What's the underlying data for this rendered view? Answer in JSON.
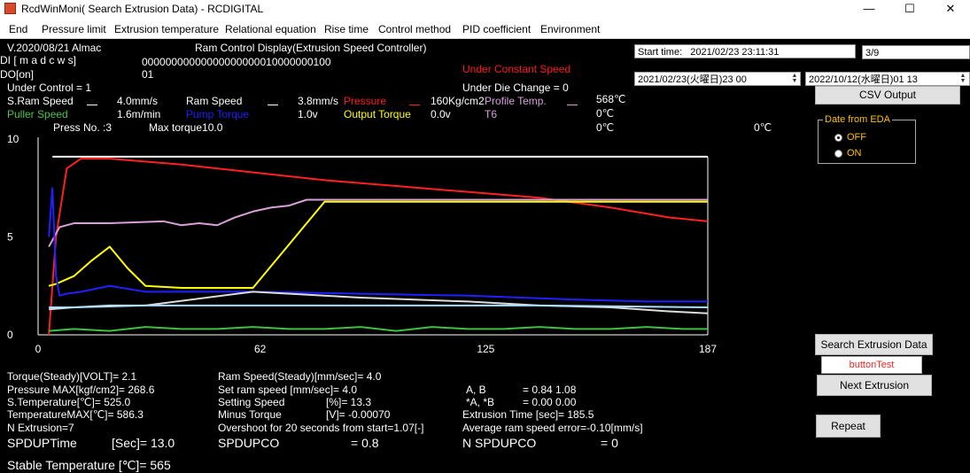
{
  "window": {
    "title": "RcdWinMoni( Search Extrusion Data) - RCDIGITAL",
    "minimize": "—",
    "maximize": "☐",
    "close": "✕"
  },
  "menu": [
    "End",
    "Pressure limit",
    "Extrusion temperature",
    "Relational equation",
    "Rise time",
    "Control method",
    "PID coefficient",
    "Environment"
  ],
  "header": {
    "version": "V.2020/08/21 Almac",
    "display_title": "Ram Control Display(Extrusion Speed Controller)",
    "di_label": "DI [ m a d c w s]",
    "di_value": "00000000000000000000010000000100",
    "do_label": "DO[on]",
    "do_value": "01",
    "under_constant_speed": "Under Constant Speed",
    "under_control": "Under Control = 1",
    "under_die_change": "Under Die Change = 0"
  },
  "readings": {
    "s_ram_speed_label": "S.Ram Speed",
    "s_ram_speed_value": "4.0mm/s",
    "ram_speed_label": "Ram Speed",
    "ram_speed_value": "3.8mm/s",
    "pressure_label": "Pressure",
    "pressure_value": "160Kg/cm2",
    "profile_temp_label": "Profile Temp.",
    "profile_temp_value": "568℃",
    "puller_speed_label": "Puller Speed",
    "puller_speed_value": "1.6m/min",
    "pump_torque_label": "Pump Torque",
    "pump_torque_value": "1.0v",
    "output_torque_label": "Output Torque",
    "output_torque_value": "0.0v",
    "t6_label": "T6",
    "t6_value": "0℃",
    "press_no": "Press No. :3",
    "max_torque": "Max torque10.0",
    "temp_a": "0℃",
    "temp_b": "0℃"
  },
  "right_panel": {
    "start_time_label": "Start time:",
    "start_time_value": "2021/02/23 23:11:31",
    "page": "3/9",
    "date_from": "2021/02/23(火曜日)23 00",
    "date_to": "2022/10/12(水曜日)01 13",
    "csv_output": "CSV Output",
    "eda_group": "Date from EDA",
    "eda_off": "OFF",
    "eda_on": "ON",
    "search_button": "Search Extrusion Data",
    "button_test": "buttonTest",
    "next_button": "Next Extrusion",
    "repeat_button": "Repeat"
  },
  "stats": {
    "torque": "Torque(Steady)[VOLT]= 2.1",
    "pressure_max": "Pressure MAX[kgf/cm2]= 268.6",
    "s_temperature": "S.Temperature[℃]= 525.0",
    "temperature_max": "TemperatureMAX[℃]= 586.3",
    "n_extrusion": "N Extrusion=7",
    "spdup_time_label": "SPDUPTime",
    "spdup_time_value": "[Sec]= 13.0",
    "stable_temp": "Stable  Temperature [℃]= 565",
    "ram_speed_steady": "Ram Speed(Steady)[mm/sec]= 4.0",
    "set_ram_speed": "Set ram speed [mm/sec]= 4.0",
    "setting_speed_label": "Setting Speed",
    "setting_speed_value": "[%]= 13.3",
    "minus_torque_label": "Minus Torque",
    "minus_torque_value": "[V]= -0.00070",
    "overshoot": "Overshoot  for 20 seconds from start=1.07[-]",
    "spdupco_label": "SPDUPCO",
    "spdupco_value": "= 0.8",
    "ab_label": "A,  B",
    "ab_value": "= 0.84 1.08",
    "star_ab_label": "*A,  *B",
    "star_ab_value": "= 0.00 0.00",
    "extrusion_time": "Extrusion Time [sec]= 185.5",
    "avg_error": "Average ram speed error=-0.10[mm/s]",
    "n_spdupco_label": "N SPDUPCO",
    "n_spdupco_value": "= 0"
  },
  "chart_data": {
    "type": "line",
    "x_ticks": [
      "0",
      "62",
      "125",
      "187"
    ],
    "y_ticks": [
      "0",
      "5",
      "10"
    ],
    "xlim": [
      0,
      187
    ],
    "ylim": [
      0,
      10
    ],
    "grid": false,
    "series": [
      {
        "color": "#ffffff",
        "x": [
          4,
          187
        ],
        "y": [
          9.1,
          9.1
        ]
      },
      {
        "color": "#ff2020",
        "x": [
          3,
          5,
          8,
          12,
          20,
          40,
          60,
          80,
          100,
          120,
          140,
          160,
          176,
          187
        ],
        "y": [
          0,
          5.0,
          8.5,
          9.0,
          9.0,
          8.7,
          8.3,
          7.9,
          7.6,
          7.3,
          7.0,
          6.5,
          6.0,
          5.8
        ]
      },
      {
        "color": "#d9a0d9",
        "x": [
          3,
          6,
          10,
          20,
          35,
          40,
          45,
          50,
          55,
          60,
          65,
          70,
          75,
          80,
          187
        ],
        "y": [
          4.5,
          5.5,
          5.7,
          5.7,
          5.8,
          5.6,
          5.7,
          5.6,
          6.0,
          6.3,
          6.5,
          6.6,
          6.9,
          6.9,
          6.9
        ]
      },
      {
        "color": "#ffff00",
        "x": [
          3,
          5,
          10,
          15,
          20,
          25,
          30,
          40,
          60,
          80,
          100,
          140,
          187
        ],
        "y": [
          2.5,
          2.6,
          3.0,
          3.8,
          4.5,
          3.4,
          2.5,
          2.4,
          2.4,
          6.8,
          6.8,
          6.8,
          6.8
        ]
      },
      {
        "color": "#2020ff",
        "x": [
          3,
          4,
          5,
          6,
          8,
          12,
          20,
          30,
          60,
          90,
          120,
          150,
          170,
          187
        ],
        "y": [
          5.0,
          7.5,
          3.0,
          2.0,
          2.1,
          2.2,
          2.5,
          2.2,
          2.2,
          2.1,
          2.0,
          1.8,
          1.7,
          1.7
        ]
      },
      {
        "color": "#dddddd",
        "x": [
          3,
          10,
          20,
          30,
          60,
          90,
          120,
          140,
          160,
          176,
          187
        ],
        "y": [
          1.3,
          1.4,
          1.5,
          1.5,
          2.2,
          1.9,
          1.7,
          1.5,
          1.4,
          1.2,
          1.1
        ]
      },
      {
        "color": "#aaddff",
        "x": [
          3,
          10,
          30,
          60,
          100,
          140,
          187
        ],
        "y": [
          1.4,
          1.4,
          1.5,
          1.5,
          1.5,
          1.5,
          1.4
        ]
      },
      {
        "color": "#40c040",
        "x": [
          3,
          10,
          20,
          30,
          40,
          50,
          60,
          70,
          80,
          90,
          100,
          110,
          120,
          130,
          140,
          150,
          160,
          170,
          180,
          187
        ],
        "y": [
          0.2,
          0.3,
          0.2,
          0.4,
          0.3,
          0.3,
          0.4,
          0.3,
          0.3,
          0.4,
          0.2,
          0.4,
          0.3,
          0.3,
          0.4,
          0.3,
          0.3,
          0.4,
          0.3,
          0.3
        ]
      }
    ]
  }
}
